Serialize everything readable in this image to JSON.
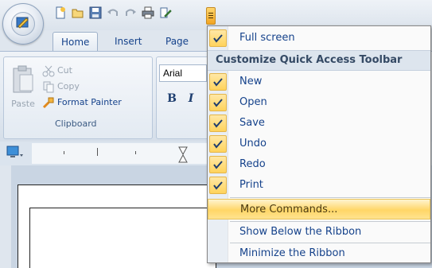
{
  "tabs": {
    "home": "Home",
    "insert": "Insert",
    "page_layout": "Page I"
  },
  "clipboard": {
    "paste": "Paste",
    "cut": "Cut",
    "copy": "Copy",
    "format_painter": "Format Painter",
    "group_label": "Clipboard"
  },
  "font": {
    "name": "Arial",
    "bold": "B",
    "italic": "I"
  },
  "menu": {
    "full_screen": "Full screen",
    "header": "Customize Quick Access Toolbar",
    "items": [
      {
        "label": "New",
        "checked": true
      },
      {
        "label": "Open",
        "checked": true
      },
      {
        "label": "Save",
        "checked": true
      },
      {
        "label": "Undo",
        "checked": true
      },
      {
        "label": "Redo",
        "checked": true
      },
      {
        "label": "Print",
        "checked": true
      }
    ],
    "more_commands": "More Commands...",
    "show_below": "Show Below the Ribbon",
    "minimize": "Minimize the Ribbon"
  },
  "colors": {
    "accent_text": "#15428b",
    "highlight": "#ffd667",
    "ribbon_bg": "#e2e9f1"
  }
}
